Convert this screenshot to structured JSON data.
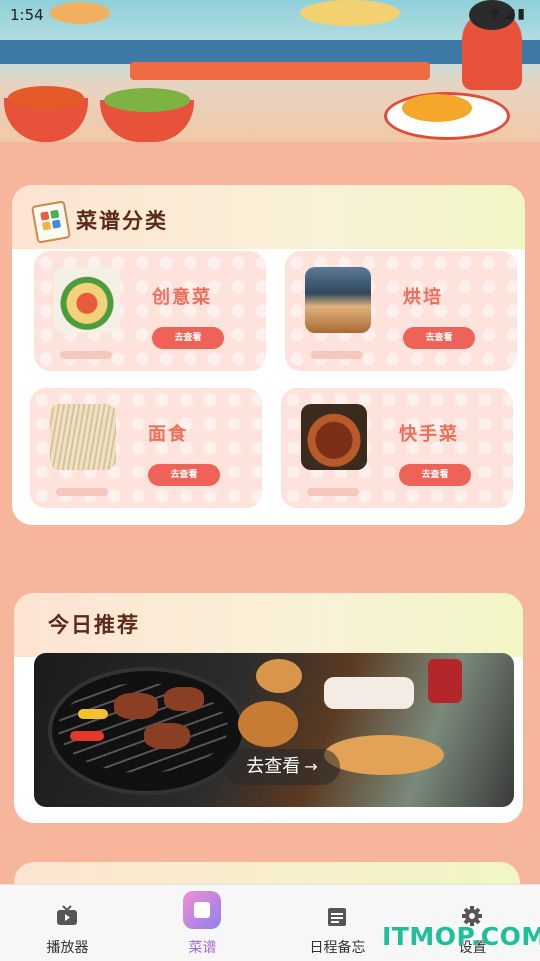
{
  "status_bar": {
    "time": "1:54",
    "icons": "▼◢▮"
  },
  "categories_section": {
    "title": "菜谱分类",
    "items": [
      {
        "name": "创意菜",
        "button": "去查看"
      },
      {
        "name": "烘培",
        "button": "去查看"
      },
      {
        "name": "面食",
        "button": "去查看"
      },
      {
        "name": "快手菜",
        "button": "去查看"
      }
    ]
  },
  "recommend_section": {
    "title": "今日推荐",
    "button": "去查看",
    "button_arrow": "→"
  },
  "tabbar": {
    "active": "菜谱",
    "tabs": [
      {
        "label": "播放器",
        "icon": "tv-icon"
      },
      {
        "label": "菜谱",
        "icon": "recipe-icon"
      },
      {
        "label": "日程备忘",
        "icon": "calendar-icon"
      },
      {
        "label": "设置",
        "icon": "gear-icon"
      }
    ]
  },
  "watermark": "ITMOP.COM",
  "colors": {
    "background": "#f7b59c",
    "accent": "#ee6258",
    "active_tab": "#a36bd6"
  }
}
